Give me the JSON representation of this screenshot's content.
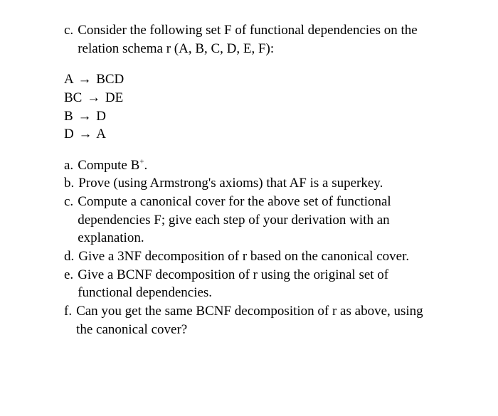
{
  "problem": {
    "label": "c.",
    "intro": "Consider the following set F of functional dependencies on the relation schema r (A, B, C, D, E, F):"
  },
  "fds": [
    {
      "left": "A",
      "right": "BCD"
    },
    {
      "left": "BC",
      "right": "DE"
    },
    {
      "left": "B",
      "right": "D"
    },
    {
      "left": "D",
      "right": "A"
    }
  ],
  "arrow": "→",
  "subs": [
    {
      "label": "a.",
      "text_pre": "Compute B",
      "sup": "+",
      "text_post": "."
    },
    {
      "label": "b.",
      "text": "Prove (using Armstrong's axioms) that AF is a superkey."
    },
    {
      "label": "c.",
      "text": "Compute a canonical cover for the above set of functional dependencies F; give each step of your derivation with an explanation."
    },
    {
      "label": "d.",
      "text": "Give a 3NF decomposition of r based on the canonical cover."
    },
    {
      "label": "e.",
      "text": "Give a BCNF decomposition of r using the original set of functional dependencies."
    },
    {
      "label": "f.",
      "text": "Can you get the same BCNF decomposition of r as above, using the canonical cover?"
    }
  ]
}
